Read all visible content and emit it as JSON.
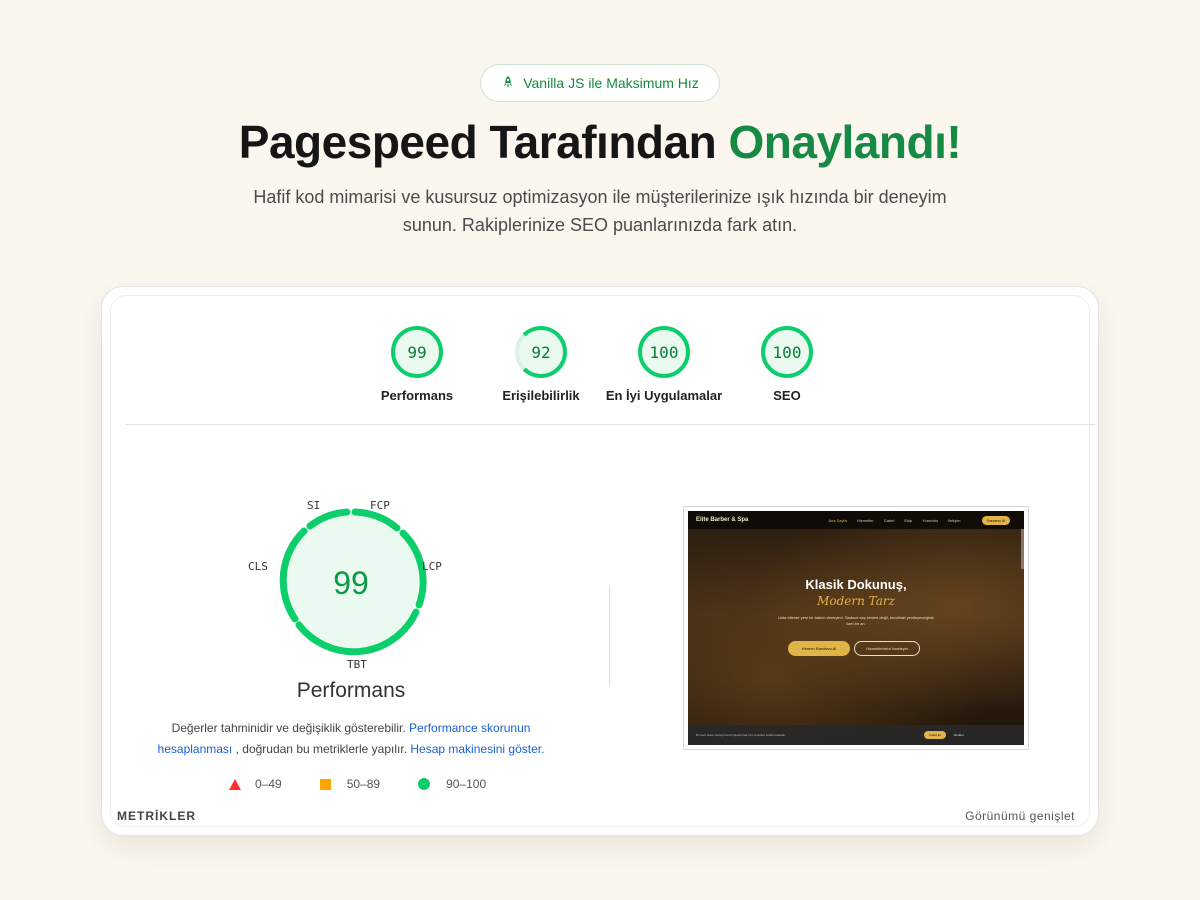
{
  "badge": {
    "icon": "rocket-icon",
    "label": "Vanilla JS ile Maksimum Hız"
  },
  "hero": {
    "title_main": "Pagespeed Tarafından ",
    "title_accent": "Onaylandı!",
    "subtitle": "Hafif kod mimarisi ve kusursuz optimizasyon ile müşterilerinize ışık hızında bir deneyim sunun. Rakiplerinize SEO puanlarınızda fark atın."
  },
  "scores": [
    {
      "value": "99",
      "label": "Performans",
      "fraction": 0.99
    },
    {
      "value": "92",
      "label": "Erişilebilirlik",
      "fraction": 0.92
    },
    {
      "value": "100",
      "label": "En İyi Uygulamalar",
      "fraction": 1.0
    },
    {
      "value": "100",
      "label": "SEO",
      "fraction": 1.0
    }
  ],
  "performance": {
    "score": "99",
    "title": "Performans",
    "metrics": {
      "si": "SI",
      "fcp": "FCP",
      "lcp": "LCP",
      "tbt": "TBT",
      "cls": "CLS"
    },
    "note_text1": "Değerler tahminidir ve değişiklik gösterebilir. ",
    "note_link1": "Performance skorunun hesaplanması",
    "note_text2": " , doğrudan bu metriklerle yapılır. ",
    "note_link2": "Hesap makinesini göster."
  },
  "legend": {
    "fail": "0–49",
    "average": "50–89",
    "pass": "90–100"
  },
  "footer": {
    "left": "METRİKLER",
    "right": "Görünümü genişlet"
  },
  "screenshot": {
    "brand": "Elite Barber & Spa",
    "nav": [
      "Ana Sayfa",
      "Hizmetler",
      "Galeri",
      "Ekip",
      "Yorumlar",
      "İletişim"
    ],
    "nav_cta": "Randevu Al",
    "heading": "Klasik Dokunuş,",
    "heading_accent": "Modern Tarz",
    "paragraph": "Usta ellerde yeni bir bakım deneyimi. Sadece saç kesimi değil, kendinizi yenileyeceğiniz özel bir an.",
    "btn_primary": "Hemen Randevu Al",
    "btn_secondary": "Hizmetlerimizi İnceleyin",
    "cookie_text": "Bu web sitesi, deneyiminizi iyileştirmek için çerezleri kullanmaktadır.",
    "cookie_accept": "Kabul Et",
    "cookie_deny": "Reddet"
  },
  "colors": {
    "background": "#fbf7ef",
    "accent_green": "#168a45",
    "pass": "#0cce6b",
    "average": "#ffa400",
    "fail": "#ff3333",
    "link": "#1a5fd6",
    "gold": "#e0b447"
  }
}
